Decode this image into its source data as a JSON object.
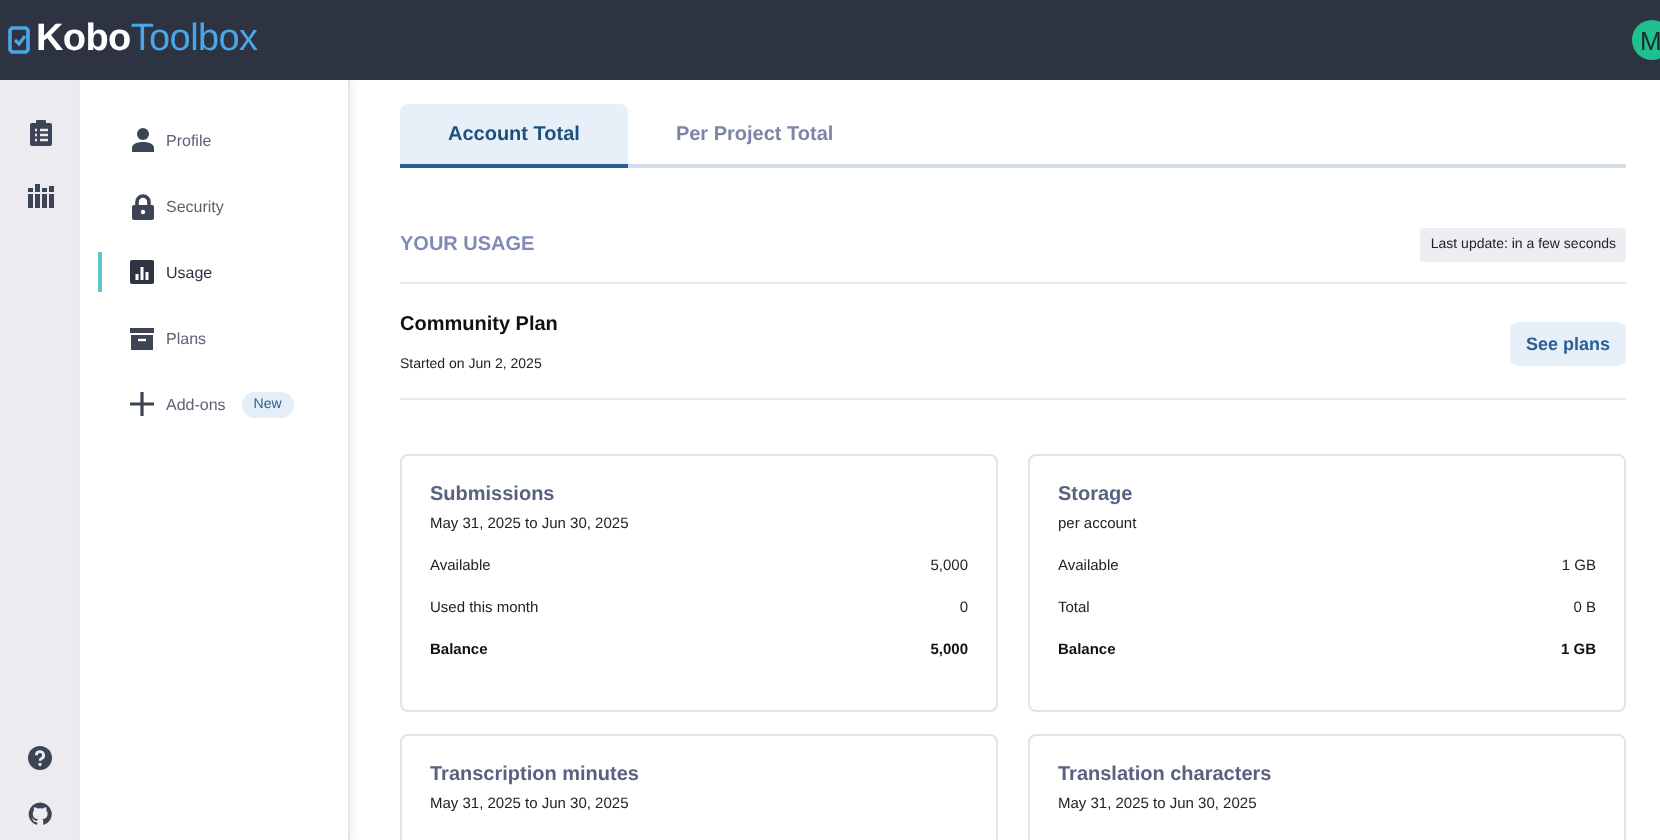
{
  "header": {
    "logo_first": "Kobo",
    "logo_second": "Toolbox",
    "avatar_letter": "M"
  },
  "nav": [
    {
      "label": "Profile",
      "selected": false
    },
    {
      "label": "Security",
      "selected": false
    },
    {
      "label": "Usage",
      "selected": true
    },
    {
      "label": "Plans",
      "selected": false
    },
    {
      "label": "Add-ons",
      "selected": false,
      "badge": "New"
    }
  ],
  "tabs": [
    {
      "label": "Account Total",
      "selected": true
    },
    {
      "label": "Per Project Total",
      "selected": false
    }
  ],
  "section_title": "YOUR USAGE",
  "last_update": "Last update: in a few seconds",
  "plan": {
    "name": "Community Plan",
    "started": "Started on Jun 2, 2025",
    "button": "See plans"
  },
  "cards": [
    {
      "title": "Submissions",
      "subtitle": "May 31, 2025 to Jun 30, 2025",
      "rows": [
        {
          "label": "Available",
          "value": "5,000",
          "kind": "line"
        },
        {
          "label": "Used this month",
          "value": "0",
          "kind": "line"
        },
        {
          "label": "Balance",
          "value": "5,000",
          "kind": "total"
        }
      ]
    },
    {
      "title": "Storage",
      "subtitle": "per account",
      "rows": [
        {
          "label": "Available",
          "value": "1 GB",
          "kind": "line"
        },
        {
          "label": "Total",
          "value": "0 B",
          "kind": "line"
        },
        {
          "label": "Balance",
          "value": "1 GB",
          "kind": "total"
        }
      ]
    },
    {
      "title": "Transcription minutes",
      "subtitle": "May 31, 2025 to Jun 30, 2025"
    },
    {
      "title": "Translation characters",
      "subtitle": "May 31, 2025 to Jun 30, 2025"
    }
  ]
}
